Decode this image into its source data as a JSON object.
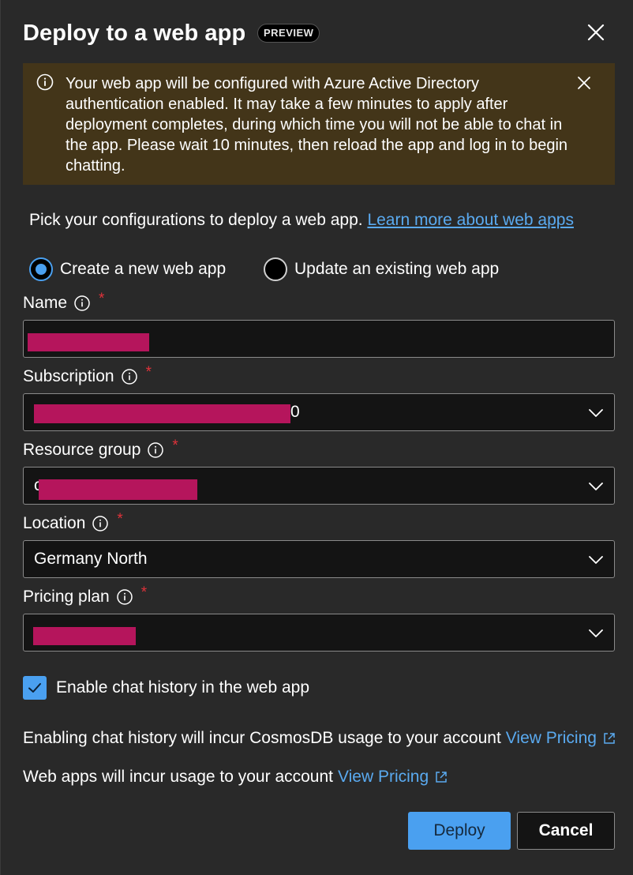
{
  "dialog": {
    "title": "Deploy to a web app",
    "badge": "PREVIEW"
  },
  "banner": {
    "text": "Your web app will be configured with Azure Active Directory authentication enabled. It may take a few minutes to apply after deployment completes, during which time you will not be able to chat in the app. Please wait 10 minutes, then reload the app and log in to begin chatting."
  },
  "intro": {
    "text": "Pick your configurations to deploy a web app.",
    "link": "Learn more about web apps"
  },
  "mode": {
    "create_label": "Create a new web app",
    "update_label": "Update an existing web app",
    "selected": "create"
  },
  "form": {
    "name_label": "Name",
    "subscription_label": "Subscription",
    "subscription_visible_suffix": "0",
    "resource_group_label": "Resource group",
    "resource_group_visible_prefix": "c",
    "location_label": "Location",
    "location_value": "Germany North",
    "pricing_label": "Pricing plan",
    "required_mark": "*"
  },
  "chat_history": {
    "label": "Enable chat history in the web app",
    "checked": true
  },
  "notes": {
    "cosmos_text": "Enabling chat history will incur CosmosDB usage to your account",
    "webapp_text": "Web apps will incur usage to your account",
    "pricing_link": "View Pricing"
  },
  "buttons": {
    "deploy": "Deploy",
    "cancel": "Cancel"
  },
  "colors": {
    "accent": "#4aa0f0",
    "banner_bg": "#433519",
    "required": "#e0323a",
    "redaction": "#b5155c"
  }
}
